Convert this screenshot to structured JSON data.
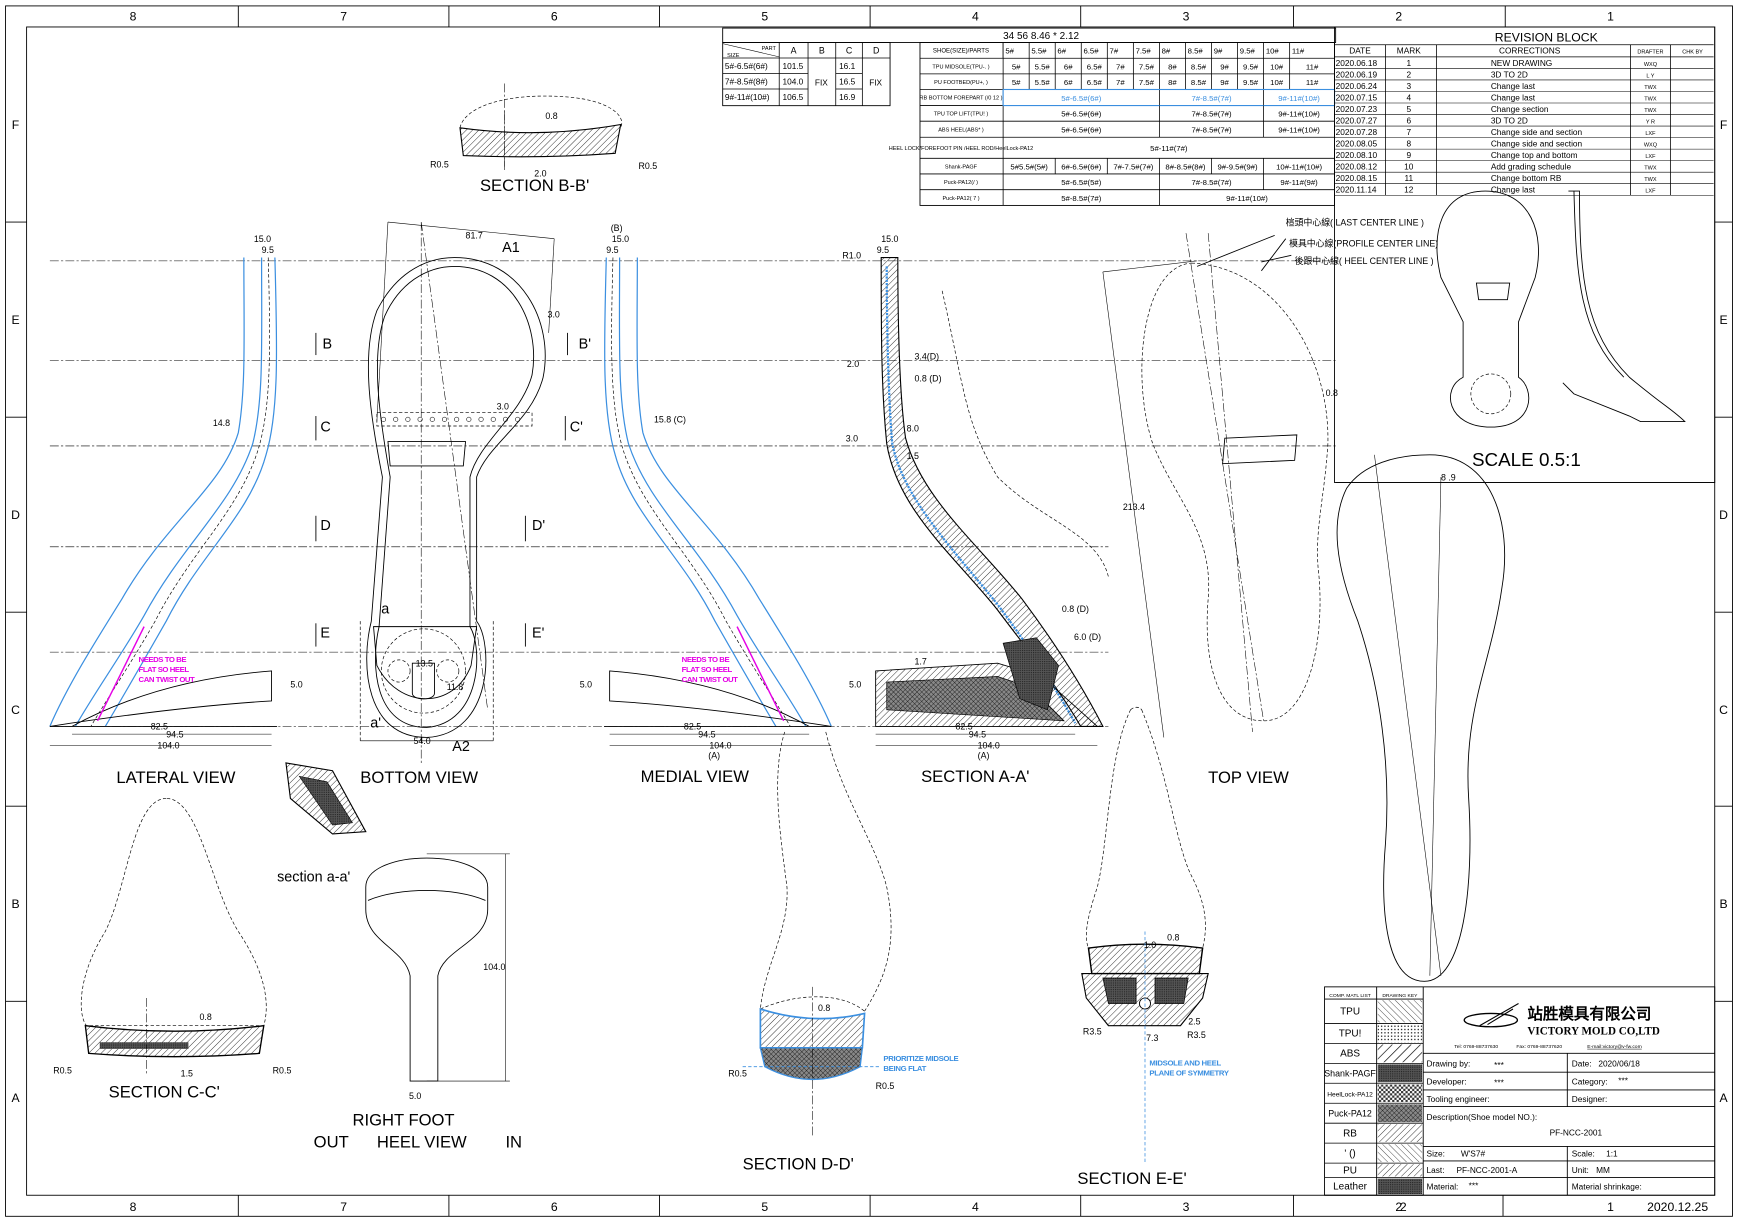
{
  "colors": {
    "line": "#000000",
    "blue": "#3b8fe0",
    "magenta": "#e600e6"
  },
  "sheet": {
    "columns": [
      "8",
      "7",
      "6",
      "5",
      "4",
      "3",
      "2",
      "1"
    ],
    "rows": [
      "F",
      "E",
      "D",
      "C",
      "B",
      "A"
    ]
  },
  "part_table": {
    "header_part": "PART",
    "header_size": "SIZE",
    "columns": [
      "A",
      "B",
      "C",
      "D"
    ],
    "fix_b": "FIX",
    "fix_d": "FIX",
    "rows": [
      {
        "size": "5#-6.5#(6#)",
        "a": "101.5",
        "c": "16.1"
      },
      {
        "size": "7#-8.5#(8#)",
        "a": "104.0",
        "c": "16.5"
      },
      {
        "size": "9#-11#(10#)",
        "a": "106.5",
        "c": "16.9"
      }
    ]
  },
  "grading_table": {
    "caption": "34   56        8.46 * 2.12",
    "header_label": "SHOE(SIZE)/PARTS",
    "sizes": [
      "5#",
      "5.5#",
      "6#",
      "6.5#",
      "7#",
      "7.5#",
      "8#",
      "8.5#",
      "9#",
      "9.5#",
      "10#",
      "11#"
    ],
    "rows": [
      {
        "label": "TPU MIDSOLE(TPU-.   )",
        "cells": [
          {
            "text": "5#",
            "span": 1
          },
          {
            "text": "5.5#",
            "span": 1
          },
          {
            "text": "6#",
            "span": 1
          },
          {
            "text": "6.5#",
            "span": 1
          },
          {
            "text": "7#",
            "span": 1
          },
          {
            "text": "7.5#",
            "span": 1
          },
          {
            "text": "8#",
            "span": 1
          },
          {
            "text": "8.5#",
            "span": 1
          },
          {
            "text": "9#",
            "span": 1
          },
          {
            "text": "9.5#",
            "span": 1
          },
          {
            "text": "10#",
            "span": 1
          },
          {
            "text": "11#",
            "span": 1
          }
        ]
      },
      {
        "label": "PU FOOTBED(PU+,   )",
        "cells": [
          {
            "text": "5#",
            "span": 1
          },
          {
            "text": "5.5#",
            "span": 1
          },
          {
            "text": "6#",
            "span": 1
          },
          {
            "text": "6.5#",
            "span": 1
          },
          {
            "text": "7#",
            "span": 1
          },
          {
            "text": "7.5#",
            "span": 1
          },
          {
            "text": "8#",
            "span": 1
          },
          {
            "text": "8.5#",
            "span": 1
          },
          {
            "text": "9#",
            "span": 1
          },
          {
            "text": "9.5#",
            "span": 1
          },
          {
            "text": "10#",
            "span": 1
          },
          {
            "text": "11#",
            "span": 1
          }
        ]
      },
      {
        "label": "RB BOTTOM FOREPART (/0  12  )",
        "highlight": true,
        "cells": [
          {
            "text": "5#-6.5#(6#)",
            "span": 6
          },
          {
            "text": "7#-8.5#(7#)",
            "span": 4
          },
          {
            "text": "9#-11#(10#)",
            "span": 2
          }
        ]
      },
      {
        "label": "TPU TOP LIFT(TPU!   )",
        "cells": [
          {
            "text": "5#-6.5#(6#)",
            "span": 6
          },
          {
            "text": "7#-8.5#(7#)",
            "span": 4
          },
          {
            "text": "9#-11#(10#)",
            "span": 2
          }
        ]
      },
      {
        "label": "ABS HEEL(ABS*  )",
        "cells": [
          {
            "text": "5#-6.5#(6#)",
            "span": 6
          },
          {
            "text": "7#-8.5#(7#)",
            "span": 4
          },
          {
            "text": "9#-11#(10#)",
            "span": 2
          }
        ]
      },
      {
        "label": "HEEL LOCK/FOREFOOT PIN /HEEL ROD/HeelLock-PA12",
        "cells": [
          {
            "text": "5#-11#(7#)",
            "span": 12
          }
        ]
      },
      {
        "label": "Shank-PAGF",
        "cells": [
          {
            "text": "5#5.5#(5#)",
            "span": 2
          },
          {
            "text": "6#-6.5#(6#)",
            "span": 2
          },
          {
            "text": "7#-7.5#(7#)",
            "span": 2
          },
          {
            "text": "8#-8.5#(8#)",
            "span": 2
          },
          {
            "text": "9#-9.5#(9#)",
            "span": 2
          },
          {
            "text": "10#-11#(10#)",
            "span": 2
          }
        ]
      },
      {
        "label": "Puck-PA12(/  )",
        "cells": [
          {
            "text": "5#-6.5#(5#)",
            "span": 6
          },
          {
            "text": "7#-8.5#(7#)",
            "span": 4
          },
          {
            "text": "9#-11#(9#)",
            "span": 2
          }
        ]
      },
      {
        "label": "Puck-PA12( 7 )",
        "cells": [
          {
            "text": "5#-8.5#(7#)",
            "span": 6
          },
          {
            "text": "9#-11#(10#)",
            "span": 6
          }
        ]
      }
    ]
  },
  "revision_block": {
    "title": "REVISION   BLOCK",
    "headers": [
      "DATE",
      "MARK",
      "CORRECTIONS",
      "DRAFTER",
      "CHK BY"
    ],
    "rows": [
      [
        "2020.06.18",
        "1",
        "NEW DRAWING",
        "WXQ",
        ""
      ],
      [
        "2020.06.19",
        "2",
        "3D TO 2D",
        "L Y",
        ""
      ],
      [
        "2020.06.24",
        "3",
        "Change last",
        "TWX",
        ""
      ],
      [
        "2020.07.15",
        "4",
        "Change last",
        "TWX",
        ""
      ],
      [
        "2020.07.23",
        "5",
        "Change section",
        "TWX",
        ""
      ],
      [
        "2020.07.27",
        "6",
        "3D TO 2D",
        "Y R",
        ""
      ],
      [
        "2020.07.28",
        "7",
        "Change side and section",
        "LXF",
        ""
      ],
      [
        "2020.08.05",
        "8",
        "Change side and section",
        "WXQ",
        ""
      ],
      [
        "2020.08.10",
        "9",
        "Change top and bottom",
        "LXF",
        ""
      ],
      [
        "2020.08.12",
        "10",
        "Add grading schedule",
        "TWX",
        ""
      ],
      [
        "2020.08.15",
        "11",
        "Change bottom RB",
        "TWX",
        ""
      ],
      [
        "2020.11.14",
        "12",
        "Change last",
        "LXF",
        ""
      ]
    ]
  },
  "views": {
    "section_bb": {
      "title": "SECTION B-B'",
      "dims": [
        "0.8",
        "2.0",
        "R0.5",
        "R0.5"
      ]
    },
    "lateral": {
      "title": "LATERAL VIEW",
      "dims": [
        "15.0",
        "9.5",
        "14.8",
        "82.5",
        "94.5",
        "104.0",
        "5.0"
      ],
      "note": [
        "NEEDS TO BE",
        "FLAT SO HEEL",
        "CAN TWIST OUT"
      ]
    },
    "bottom": {
      "title": "BOTTOM VIEW",
      "dims": [
        "81.7",
        "A1",
        "3.0",
        "3.0",
        "13.5",
        "11.8",
        "a",
        "a'",
        "54.0",
        "A2"
      ],
      "section_marks": [
        "B",
        "C",
        "D",
        "E",
        "B'",
        "C'",
        "D'",
        "E'"
      ]
    },
    "medial": {
      "title": "MEDIAL VIEW",
      "dims": [
        "(B)",
        "15.0",
        "9.5",
        "15.8 (C)",
        "5.0",
        "82.5",
        "94.5",
        "104.0",
        "(A)"
      ],
      "note": [
        "NEEDS TO BE",
        "FLAT SO HEEL",
        "CAN TWIST OUT"
      ]
    },
    "section_aa": {
      "title": "SECTION A-A'",
      "dims": [
        "15.0",
        "9.5",
        "R1.0",
        "2.0",
        "3.4(D)",
        "0.8 (D)",
        "3.0",
        "8.0",
        "1.5",
        "0.8 (D)",
        "6.0 (D)",
        "1.7",
        "5.0",
        "82.5",
        "94.5",
        "104.0",
        "(A)"
      ]
    },
    "top": {
      "title": "TOP VIEW",
      "dims": [
        "213.4",
        "0.8"
      ],
      "center_lines": [
        "楦頭中心線( LAST CENTER LINE )",
        "模具中心線(PROFILE CENTER LINE)",
        "後跟中心線( HEEL CENTER LINE )"
      ]
    },
    "outline": {
      "dims": [
        "8 .9"
      ]
    },
    "scale_view": {
      "title": "SCALE 0.5:1"
    },
    "section_a_small": {
      "title": "section a-a'"
    },
    "section_cc": {
      "title": "SECTION C-C'",
      "dims": [
        "0.8",
        "R0.5",
        "1.5",
        "R0.5"
      ]
    },
    "heel_view": {
      "title": "RIGHT FOOT",
      "out": "OUT",
      "subtitle": "HEEL VIEW",
      "in": "IN",
      "dims": [
        "104.0",
        "5.0"
      ]
    },
    "section_dd": {
      "title": "SECTION D-D'",
      "dims": [
        "0.8",
        "R0.5",
        "R0.5"
      ],
      "note": [
        "PRIORITIZE MIDSOLE",
        "BEING FLAT"
      ]
    },
    "section_ee": {
      "title": "SECTION E-E'",
      "dims": [
        "1.0",
        "0.8",
        "2.5",
        "R3.5",
        "7.3",
        "R3.5"
      ],
      "note": [
        "MIDSOLE AND HEEL",
        "PLANE OF SYMMETRY"
      ]
    }
  },
  "title_block": {
    "materials_header": "COMP.  MATL LIST",
    "key_header": "DRAWING KEY",
    "materials": [
      "TPU",
      "TPU!",
      "ABS",
      "Shank-PAGF",
      "HeelLock-PA12",
      "Puck-PA12",
      "RB",
      "'  ()",
      "PU",
      "Leather"
    ],
    "company_cn": "站胜模具有限公司",
    "company_en": "VICTORY MOLD CO,LTD",
    "tel": "Tel: 0769-88737630",
    "fax": "Fax: 0769-88737620",
    "email": "E-mail:victory@v-fw.com",
    "drawing_by_label": "Drawing by:",
    "drawing_by": "***",
    "date_label": "Date:",
    "date": "2020/06/18",
    "developer_label": "Developer:",
    "developer": "***",
    "category_label": "Category:",
    "category": "***",
    "tooling_label": "Tooling engineer:",
    "designer_label": "Designer:",
    "description_label": "Description(Shoe  model  NO.):",
    "model_no": "PF-NCC-2001",
    "size_label": "Size:",
    "size": "W'S7#",
    "scale_label": "Scale:",
    "scale": "1:1",
    "last_label": "Last:",
    "last": "PF-NCC-2001-A",
    "unit_label": "Unit:",
    "unit": "MM",
    "material_label": "Material:",
    "material": "***",
    "shrinkage_label": "Material shrinkage:",
    "sheet_no": "2",
    "issue_date": "2020.12.25"
  }
}
